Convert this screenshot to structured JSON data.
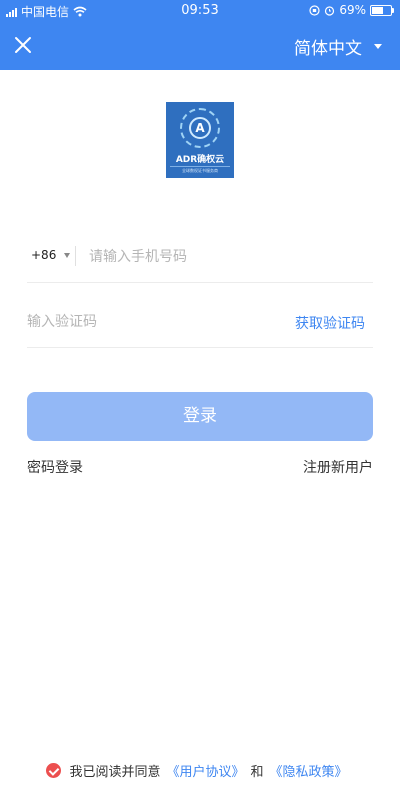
{
  "status_bar": {
    "carrier": "中国电信",
    "time": "09:53",
    "battery_percent": "69%",
    "battery_level": 0.69
  },
  "navbar": {
    "close_icon": "close-icon",
    "language": "简体中文"
  },
  "logo": {
    "letter": "A",
    "name": "ADR确权云",
    "tagline": "全球数权证书服务商"
  },
  "form": {
    "country_code": "+86",
    "phone_placeholder": "请输入手机号码",
    "phone_value": "",
    "code_placeholder": "输入验证码",
    "code_value": "",
    "get_code_label": "获取验证码"
  },
  "actions": {
    "login_label": "登录",
    "password_login_label": "密码登录",
    "register_label": "注册新用户"
  },
  "agreement": {
    "prefix": "我已阅读并同意",
    "user_agreement": "《用户协议》",
    "conjunction": "和",
    "privacy_policy": "《隐私政策》",
    "checked": true
  },
  "colors": {
    "brand": "#3e86f1",
    "login_button_disabled": "#93b8f6",
    "check_red": "#ec4f4f"
  }
}
